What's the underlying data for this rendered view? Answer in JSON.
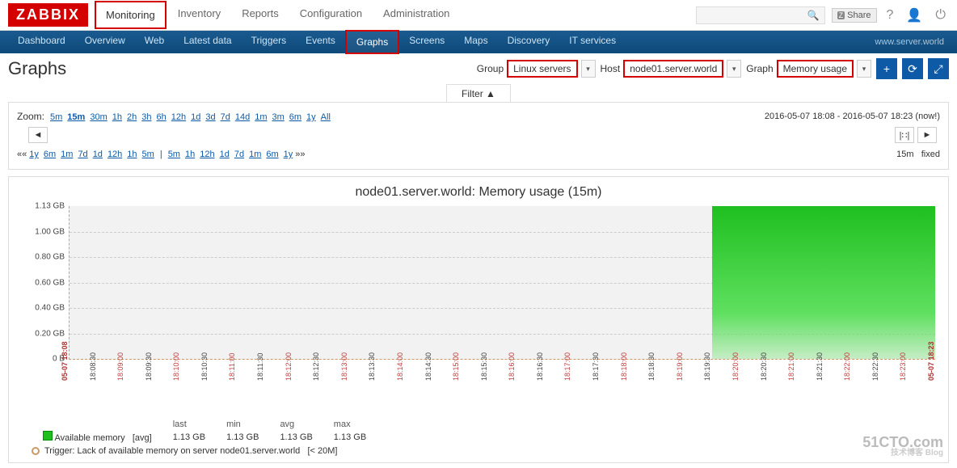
{
  "brand": "ZABBIX",
  "top_nav": {
    "items": [
      "Monitoring",
      "Inventory",
      "Reports",
      "Configuration",
      "Administration"
    ],
    "active": "Monitoring"
  },
  "top_right": {
    "share": "Share",
    "help_icon": "?",
    "user_icon": "user",
    "power_icon": "power"
  },
  "sub_nav": {
    "items": [
      "Dashboard",
      "Overview",
      "Web",
      "Latest data",
      "Triggers",
      "Events",
      "Graphs",
      "Screens",
      "Maps",
      "Discovery",
      "IT services"
    ],
    "active": "Graphs",
    "right_text": "www.server.world"
  },
  "page_title": "Graphs",
  "selectors": {
    "group_label": "Group",
    "group_value": "Linux servers",
    "host_label": "Host",
    "host_value": "node01.server.world",
    "graph_label": "Graph",
    "graph_value": "Memory usage"
  },
  "action_icons": {
    "add": "+",
    "refresh": "⟳",
    "fullscreen": "⤢"
  },
  "filter_tab": "Filter ▲",
  "zoom": {
    "label": "Zoom:",
    "options": [
      "5m",
      "15m",
      "30m",
      "1h",
      "2h",
      "3h",
      "6h",
      "12h",
      "1d",
      "3d",
      "7d",
      "14d",
      "1m",
      "3m",
      "6m",
      "1y",
      "All"
    ],
    "selected": "15m",
    "range_text": "2016-05-07 18:08 - 2016-05-07 18:23 (now!)"
  },
  "arrow_left": "◄",
  "arrow_right": "►",
  "arrow_mid": "|∷|",
  "shift": {
    "left_prefix": "««",
    "left": [
      "1y",
      "6m",
      "1m",
      "7d",
      "1d",
      "12h",
      "1h",
      "5m"
    ],
    "right": [
      "5m",
      "1h",
      "12h",
      "1d",
      "7d",
      "1m",
      "6m",
      "1y"
    ],
    "right_suffix": "»»",
    "fixed_label": "15m",
    "fixed_mode": "fixed"
  },
  "chart_data": {
    "type": "area",
    "title": "node01.server.world: Memory usage (15m)",
    "ylabel": "",
    "yticks": [
      "1.13 GB",
      "1.00 GB",
      "0.80 GB",
      "0.60 GB",
      "0.40 GB",
      "0.20 GB",
      "0 B"
    ],
    "ylim_gb": [
      0,
      1.13
    ],
    "x_start": "05-07 18:08",
    "x_end": "05-07 18:23",
    "xticks": [
      "05-07 18:08",
      "18:08:30",
      "18:09:00",
      "18:09:30",
      "18:10:00",
      "18:10:30",
      "18:11:00",
      "18:11:30",
      "18:12:00",
      "18:12:30",
      "18:13:00",
      "18:13:30",
      "18:14:00",
      "18:14:30",
      "18:15:00",
      "18:15:30",
      "18:16:00",
      "18:16:30",
      "18:17:00",
      "18:17:30",
      "18:18:00",
      "18:18:30",
      "18:19:00",
      "18:19:30",
      "18:20:00",
      "18:20:30",
      "18:21:00",
      "18:21:30",
      "18:22:00",
      "18:22:30",
      "18:23:00",
      "05-07 18:23"
    ],
    "xticks_red_every_minute": true,
    "series": [
      {
        "name": "Available memory",
        "color": "#1fbf1f",
        "data_gb": [
          null,
          null,
          null,
          null,
          null,
          null,
          null,
          null,
          null,
          null,
          null,
          null,
          null,
          null,
          null,
          null,
          null,
          null,
          null,
          null,
          null,
          null,
          null,
          1.13,
          1.13,
          1.13,
          1.13,
          1.13,
          1.13,
          1.13,
          1.13,
          1.13
        ]
      }
    ],
    "trigger": {
      "name": "Lack of available memory on server node01.server.world",
      "threshold": "< 20M"
    },
    "legend_stats": {
      "headers": [
        "",
        "last",
        "min",
        "avg",
        "max"
      ],
      "row_label": "Available memory",
      "agg_label": "[avg]",
      "values": [
        "1.13 GB",
        "1.13 GB",
        "1.13 GB",
        "1.13 GB"
      ]
    }
  },
  "watermark": {
    "line1": "51CTO.com",
    "line2": "技术博客",
    "line3": "Blog"
  }
}
